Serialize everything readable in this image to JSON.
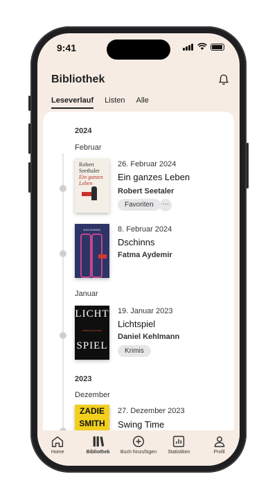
{
  "status": {
    "time": "9:41"
  },
  "header": {
    "title": "Bibliothek"
  },
  "tabs": [
    {
      "label": "Leseverlauf",
      "active": true
    },
    {
      "label": "Listen",
      "active": false
    },
    {
      "label": "Alle",
      "active": false
    }
  ],
  "timeline": {
    "year_2024": "2024",
    "month_feb": "Februar",
    "month_jan": "Januar",
    "year_2023": "2023",
    "month_dec": "Dezember"
  },
  "books": [
    {
      "date": "26. Februar 2024",
      "title": "Ein ganzes Leben",
      "author": "Robert Seetaler",
      "tags": [
        "Favoriten"
      ],
      "more": "···",
      "cover_text": [
        "Robert",
        "Seethaler",
        "Ein ganzes",
        "Leben"
      ]
    },
    {
      "date": "8. Februar 2024",
      "title": "Dschinns",
      "author": "Fatma Aydemir",
      "cover_text": [
        "DSCHINNS"
      ]
    },
    {
      "date": "19. Januar 2023",
      "title": "Lichtspiel",
      "author": "Daniel Kehlmann",
      "tags": [
        "Krimis"
      ],
      "cover_text": [
        "LICHT",
        "SPIEL",
        "DANIEL KEHLMANN"
      ]
    },
    {
      "date": "27. Dezember 2023",
      "title": "Swing Time",
      "cover_text": [
        "ZADIE",
        "SMITH"
      ]
    }
  ],
  "nav": [
    {
      "label": "Home",
      "icon": "home-icon"
    },
    {
      "label": "Bibliothek",
      "icon": "library-icon",
      "active": true
    },
    {
      "label": "Buch hinzufügen",
      "icon": "add-circle-icon"
    },
    {
      "label": "Statistiken",
      "icon": "stats-icon"
    },
    {
      "label": "Profil",
      "icon": "profile-icon"
    }
  ]
}
